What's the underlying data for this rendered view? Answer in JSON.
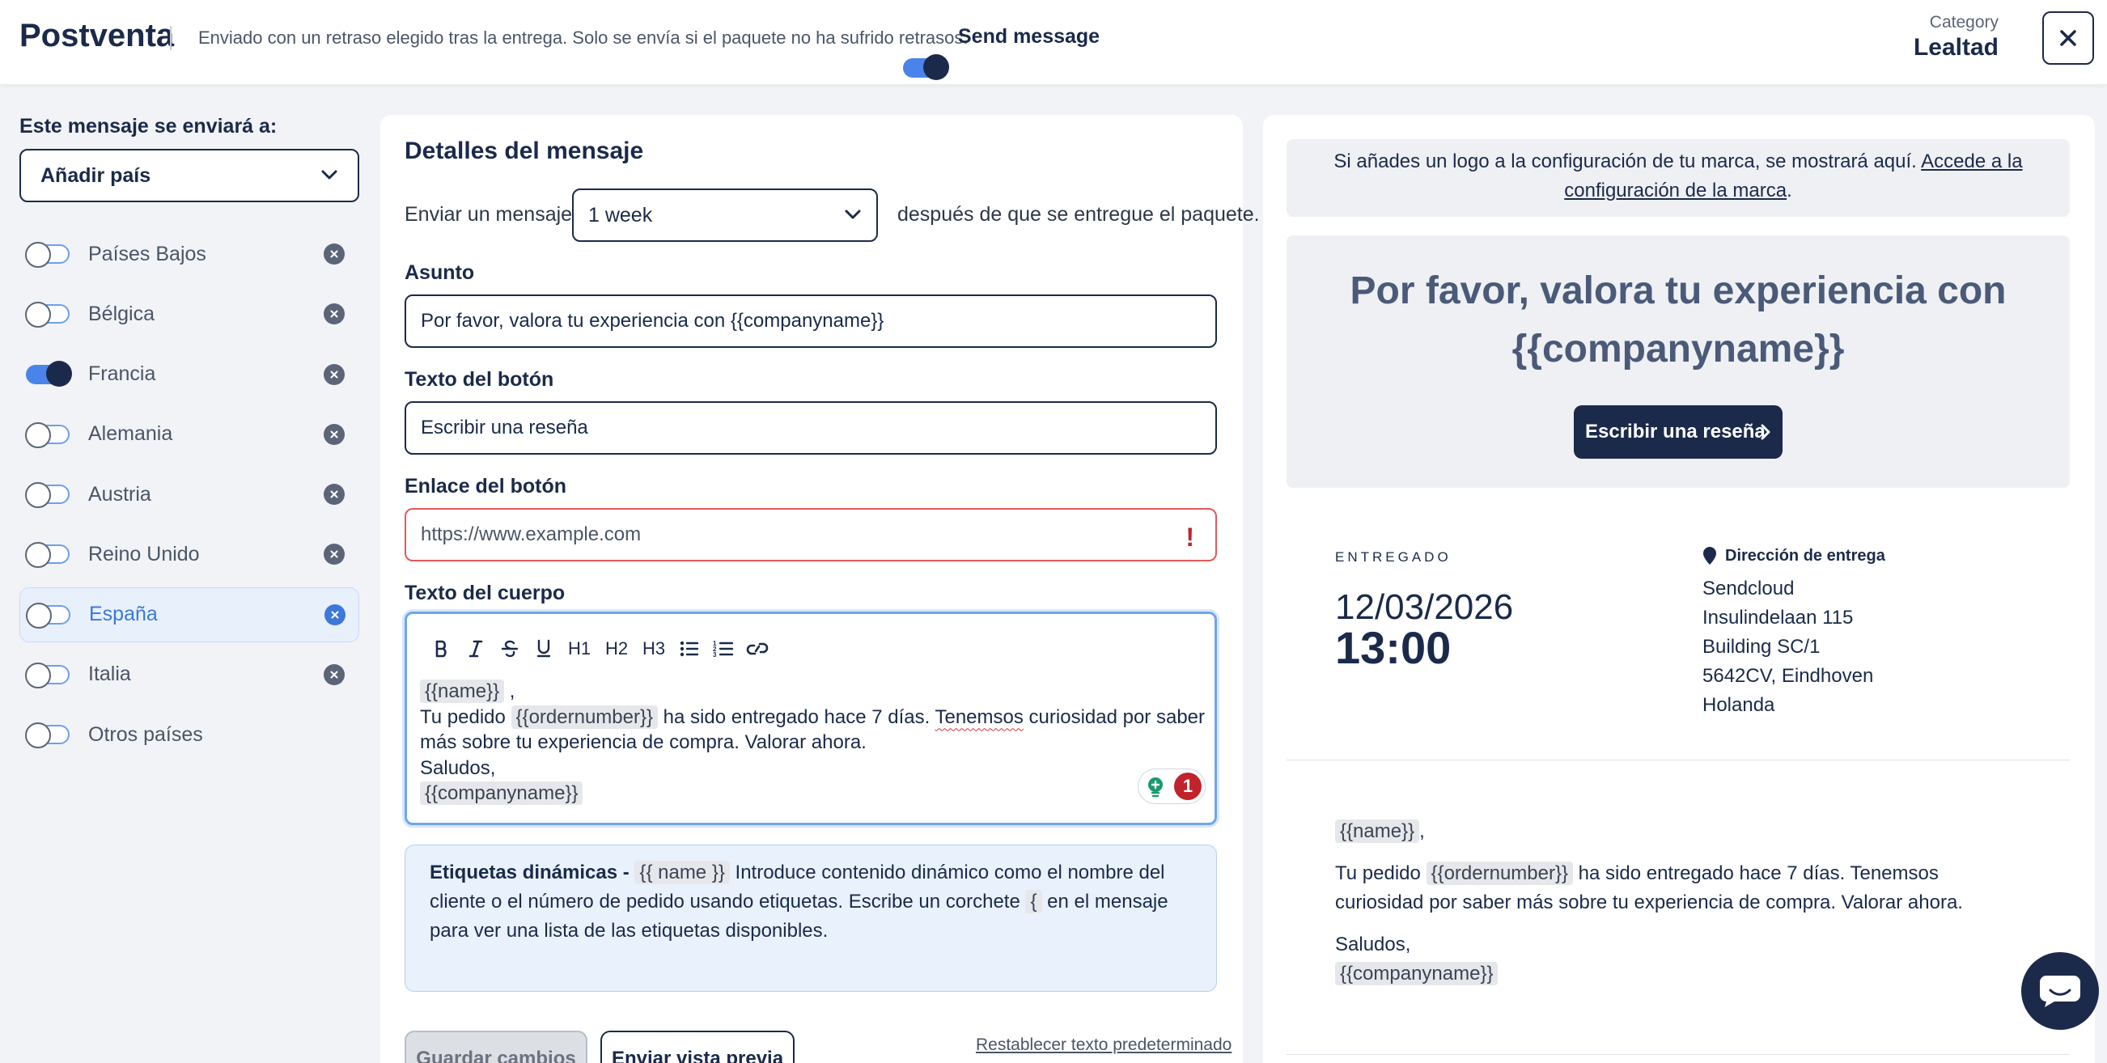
{
  "header": {
    "title": "Postventa",
    "description": "Enviado con un retraso elegido tras la entrega. Solo se envía si el paquete no ha sufrido retrasos.",
    "send_message_label": "Send message",
    "send_message_on": true,
    "category_label": "Category",
    "category_value": "Lealtad"
  },
  "sidebar": {
    "heading": "Este mensaje se enviará a:",
    "add_country": "Añadir país",
    "countries": [
      {
        "label": "Países Bajos",
        "on": false,
        "active": false
      },
      {
        "label": "Bélgica",
        "on": false,
        "active": false
      },
      {
        "label": "Francia",
        "on": true,
        "active": false
      },
      {
        "label": "Alemania",
        "on": false,
        "active": false
      },
      {
        "label": "Austria",
        "on": false,
        "active": false
      },
      {
        "label": "Reino Unido",
        "on": false,
        "active": false
      },
      {
        "label": "España",
        "on": false,
        "active": true
      },
      {
        "label": "Italia",
        "on": false,
        "active": false
      },
      {
        "label": "Otros países",
        "on": false,
        "active": false
      }
    ]
  },
  "details": {
    "title": "Detalles del mensaje",
    "send_label": "Enviar un mensaje",
    "delay_value": "1 week",
    "after_label": "después de que se entregue el paquete.",
    "subject_label": "Asunto",
    "subject_value": "Por favor, valora tu experiencia con {{companyname}}",
    "button_text_label": "Texto del botón",
    "button_text_value": "Escribir una reseña",
    "button_link_label": "Enlace del botón",
    "button_link_placeholder": "https://www.example.com",
    "body_label": "Texto del cuerpo",
    "toolbar": {
      "h1": "H1",
      "h2": "H2",
      "h3": "H3"
    },
    "body": {
      "tag_name": "{{name}}",
      "comma": ",",
      "line2_a": "Tu pedido",
      "tag_order": "{{ordernumber}}",
      "line2_b": "ha sido entregado hace 7 días.",
      "misspelled": "Tenemsos",
      "line2_c": "curiosidad por saber más sobre tu experiencia de compra. Valorar ahora.",
      "greeting": "Saludos,",
      "tag_company": "{{companyname}}"
    },
    "grammar_count": "1"
  },
  "info": {
    "title": "Etiquetas dinámicas -",
    "tag": "{{ name }}",
    "text_a": "Introduce contenido dinámico como el nombre del cliente o el número de pedido usando etiquetas. Escribe un corchete",
    "bracket": "{",
    "text_b": "en el mensaje para ver una lista de las etiquetas disponibles."
  },
  "actions": {
    "save": "Guardar cambios",
    "preview": "Enviar vista previa",
    "reset": "Restablecer texto predeterminado"
  },
  "preview": {
    "logo_note": "Si añades un logo a la configuración de tu marca, se mostrará aquí.",
    "logo_link": "Accede a la configuración de la marca",
    "logo_period": ".",
    "hero_title": "Por favor, valora tu experiencia con {{companyname}}",
    "hero_button": "Escribir una reseña",
    "delivered_label": "ENTREGADO",
    "delivered_date": "12/03/2026",
    "delivered_time": "13:00",
    "address_title": "Dirección de entrega",
    "address_lines": [
      "Sendcloud",
      "Insulindelaan 115",
      "Building SC/1",
      "5642CV, Eindhoven",
      "Holanda"
    ],
    "body_name": "{{name}}",
    "body_comma": ",",
    "body_a": "Tu pedido",
    "body_order": "{{ordernumber}}",
    "body_b": "ha sido entregado hace 7 días. Tenemsos curiosidad por saber más sobre tu experiencia de compra. Valorar ahora.",
    "body_greeting": "Saludos,",
    "body_company": "{{companyname}}"
  },
  "colors": {
    "navy": "#1b2a4a",
    "accent_blue": "#4a84ea",
    "error_red": "#c0232b",
    "background": "#f1f3f6"
  },
  "icons": [
    "close-icon",
    "chevron-down-icon",
    "remove-circle-icon",
    "bold-icon",
    "italic-icon",
    "strikethrough-icon",
    "underline-icon",
    "bullet-list-icon",
    "numbered-list-icon",
    "link-icon",
    "grammar-assistant-icon",
    "location-pin-icon",
    "chevron-right-icon",
    "chat-icon",
    "error-icon"
  ]
}
